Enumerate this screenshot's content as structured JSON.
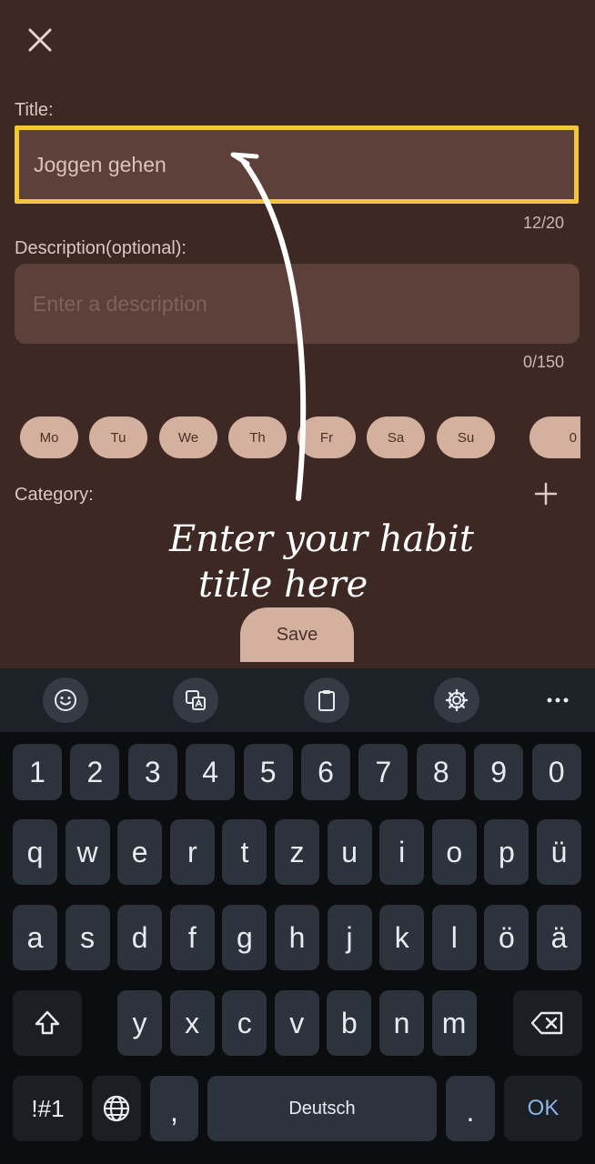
{
  "form": {
    "title_label": "Title:",
    "title_value": "Joggen gehen",
    "title_counter": "12/20",
    "description_label": "Description(optional):",
    "description_placeholder": "Enter a description",
    "description_counter": "0/150",
    "days": [
      "Mo",
      "Tu",
      "We",
      "Th",
      "Fr",
      "Sa",
      "Su"
    ],
    "partial_day_chip": "0",
    "category_label": "Category:",
    "save_label": "Save"
  },
  "annotation": {
    "line1": "Enter your habit",
    "line2": "title here"
  },
  "keyboard": {
    "toolbar_icons": [
      "emoji-icon",
      "translate-icon",
      "clipboard-icon",
      "settings-icon",
      "more-icon"
    ],
    "number_row": [
      "1",
      "2",
      "3",
      "4",
      "5",
      "6",
      "7",
      "8",
      "9",
      "0"
    ],
    "row1": [
      "q",
      "w",
      "e",
      "r",
      "t",
      "z",
      "u",
      "i",
      "o",
      "p",
      "ü"
    ],
    "row2": [
      "a",
      "s",
      "d",
      "f",
      "g",
      "h",
      "j",
      "k",
      "l",
      "ö",
      "ä"
    ],
    "row3": [
      "y",
      "x",
      "c",
      "v",
      "b",
      "n",
      "m"
    ],
    "symbols_label": "!#1",
    "comma_label": ",",
    "space_label": "Deutsch",
    "period_label": ".",
    "ok_label": "OK"
  },
  "colors": {
    "background": "#3e2824",
    "field": "#5d403a",
    "highlight": "#f4c53a",
    "chip": "#d4b19e"
  }
}
